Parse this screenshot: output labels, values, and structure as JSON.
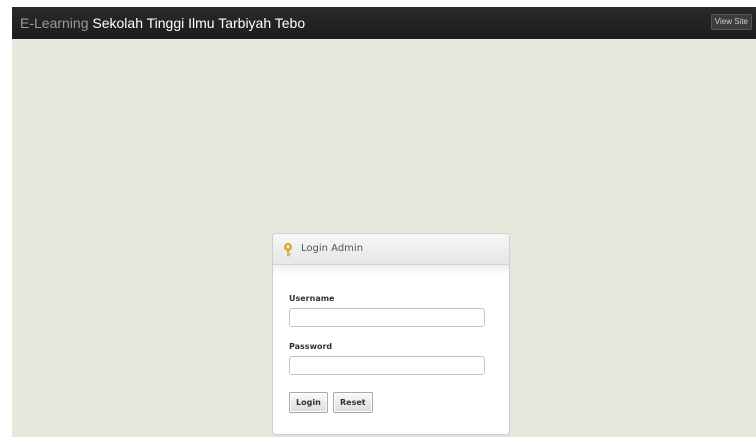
{
  "header": {
    "brand_prefix": "E-Learning",
    "brand_name": "Sekolah Tinggi Ilmu Tarbiyah Tebo",
    "view_site_label": "View Site"
  },
  "login": {
    "title": "Login Admin",
    "icon": "key-icon",
    "username_label": "Username",
    "username_value": "",
    "password_label": "Password",
    "password_value": "",
    "login_button": "Login",
    "reset_button": "Reset"
  },
  "colors": {
    "topbar": "#1f1f1f",
    "background": "#e8e8dc",
    "brand_prefix": "#9a9a9a",
    "brand_name": "#ffffff",
    "key_icon": "#e2b93b"
  }
}
